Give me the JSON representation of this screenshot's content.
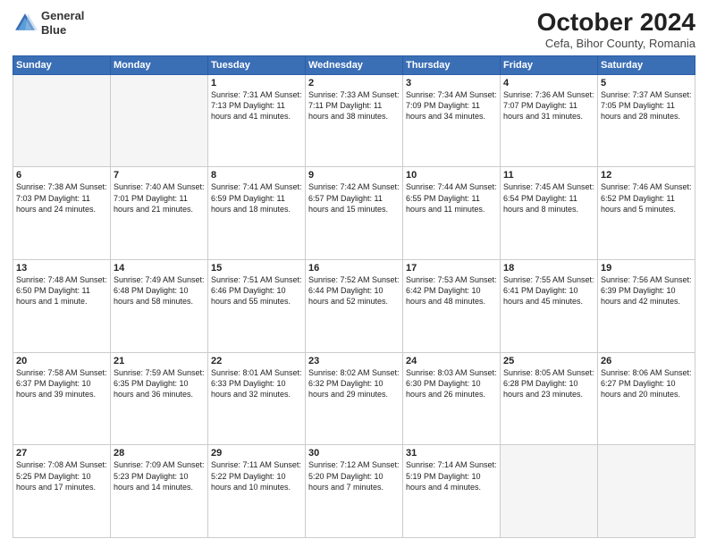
{
  "header": {
    "logo_line1": "General",
    "logo_line2": "Blue",
    "month": "October 2024",
    "location": "Cefa, Bihor County, Romania"
  },
  "weekdays": [
    "Sunday",
    "Monday",
    "Tuesday",
    "Wednesday",
    "Thursday",
    "Friday",
    "Saturday"
  ],
  "weeks": [
    [
      {
        "day": "",
        "info": ""
      },
      {
        "day": "",
        "info": ""
      },
      {
        "day": "1",
        "info": "Sunrise: 7:31 AM\nSunset: 7:13 PM\nDaylight: 11 hours and 41 minutes."
      },
      {
        "day": "2",
        "info": "Sunrise: 7:33 AM\nSunset: 7:11 PM\nDaylight: 11 hours and 38 minutes."
      },
      {
        "day": "3",
        "info": "Sunrise: 7:34 AM\nSunset: 7:09 PM\nDaylight: 11 hours and 34 minutes."
      },
      {
        "day": "4",
        "info": "Sunrise: 7:36 AM\nSunset: 7:07 PM\nDaylight: 11 hours and 31 minutes."
      },
      {
        "day": "5",
        "info": "Sunrise: 7:37 AM\nSunset: 7:05 PM\nDaylight: 11 hours and 28 minutes."
      }
    ],
    [
      {
        "day": "6",
        "info": "Sunrise: 7:38 AM\nSunset: 7:03 PM\nDaylight: 11 hours and 24 minutes."
      },
      {
        "day": "7",
        "info": "Sunrise: 7:40 AM\nSunset: 7:01 PM\nDaylight: 11 hours and 21 minutes."
      },
      {
        "day": "8",
        "info": "Sunrise: 7:41 AM\nSunset: 6:59 PM\nDaylight: 11 hours and 18 minutes."
      },
      {
        "day": "9",
        "info": "Sunrise: 7:42 AM\nSunset: 6:57 PM\nDaylight: 11 hours and 15 minutes."
      },
      {
        "day": "10",
        "info": "Sunrise: 7:44 AM\nSunset: 6:55 PM\nDaylight: 11 hours and 11 minutes."
      },
      {
        "day": "11",
        "info": "Sunrise: 7:45 AM\nSunset: 6:54 PM\nDaylight: 11 hours and 8 minutes."
      },
      {
        "day": "12",
        "info": "Sunrise: 7:46 AM\nSunset: 6:52 PM\nDaylight: 11 hours and 5 minutes."
      }
    ],
    [
      {
        "day": "13",
        "info": "Sunrise: 7:48 AM\nSunset: 6:50 PM\nDaylight: 11 hours and 1 minute."
      },
      {
        "day": "14",
        "info": "Sunrise: 7:49 AM\nSunset: 6:48 PM\nDaylight: 10 hours and 58 minutes."
      },
      {
        "day": "15",
        "info": "Sunrise: 7:51 AM\nSunset: 6:46 PM\nDaylight: 10 hours and 55 minutes."
      },
      {
        "day": "16",
        "info": "Sunrise: 7:52 AM\nSunset: 6:44 PM\nDaylight: 10 hours and 52 minutes."
      },
      {
        "day": "17",
        "info": "Sunrise: 7:53 AM\nSunset: 6:42 PM\nDaylight: 10 hours and 48 minutes."
      },
      {
        "day": "18",
        "info": "Sunrise: 7:55 AM\nSunset: 6:41 PM\nDaylight: 10 hours and 45 minutes."
      },
      {
        "day": "19",
        "info": "Sunrise: 7:56 AM\nSunset: 6:39 PM\nDaylight: 10 hours and 42 minutes."
      }
    ],
    [
      {
        "day": "20",
        "info": "Sunrise: 7:58 AM\nSunset: 6:37 PM\nDaylight: 10 hours and 39 minutes."
      },
      {
        "day": "21",
        "info": "Sunrise: 7:59 AM\nSunset: 6:35 PM\nDaylight: 10 hours and 36 minutes."
      },
      {
        "day": "22",
        "info": "Sunrise: 8:01 AM\nSunset: 6:33 PM\nDaylight: 10 hours and 32 minutes."
      },
      {
        "day": "23",
        "info": "Sunrise: 8:02 AM\nSunset: 6:32 PM\nDaylight: 10 hours and 29 minutes."
      },
      {
        "day": "24",
        "info": "Sunrise: 8:03 AM\nSunset: 6:30 PM\nDaylight: 10 hours and 26 minutes."
      },
      {
        "day": "25",
        "info": "Sunrise: 8:05 AM\nSunset: 6:28 PM\nDaylight: 10 hours and 23 minutes."
      },
      {
        "day": "26",
        "info": "Sunrise: 8:06 AM\nSunset: 6:27 PM\nDaylight: 10 hours and 20 minutes."
      }
    ],
    [
      {
        "day": "27",
        "info": "Sunrise: 7:08 AM\nSunset: 5:25 PM\nDaylight: 10 hours and 17 minutes."
      },
      {
        "day": "28",
        "info": "Sunrise: 7:09 AM\nSunset: 5:23 PM\nDaylight: 10 hours and 14 minutes."
      },
      {
        "day": "29",
        "info": "Sunrise: 7:11 AM\nSunset: 5:22 PM\nDaylight: 10 hours and 10 minutes."
      },
      {
        "day": "30",
        "info": "Sunrise: 7:12 AM\nSunset: 5:20 PM\nDaylight: 10 hours and 7 minutes."
      },
      {
        "day": "31",
        "info": "Sunrise: 7:14 AM\nSunset: 5:19 PM\nDaylight: 10 hours and 4 minutes."
      },
      {
        "day": "",
        "info": ""
      },
      {
        "day": "",
        "info": ""
      }
    ]
  ]
}
